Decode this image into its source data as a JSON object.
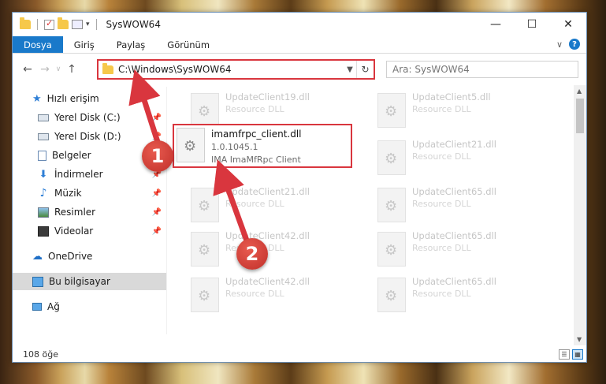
{
  "window": {
    "title": "SysWOW64",
    "controls": {
      "minimize": "—",
      "maximize": "☐",
      "close": "✕"
    }
  },
  "ribbon": {
    "tabs": [
      "Dosya",
      "Giriş",
      "Paylaş",
      "Görünüm"
    ],
    "expand": "∨",
    "help": "?"
  },
  "address": {
    "path": "C:\\Windows\\SysWOW64",
    "refresh": "↻"
  },
  "search": {
    "placeholder": "Ara: SysWOW64"
  },
  "nav": {
    "quick_access": "Hızlı erişim",
    "items": [
      {
        "label": "Yerel Disk (C:)",
        "icon": "drive-icon"
      },
      {
        "label": "Yerel Disk (D:)",
        "icon": "drive-icon"
      },
      {
        "label": "Belgeler",
        "icon": "documents-icon"
      },
      {
        "label": "İndirmeler",
        "icon": "download-icon"
      },
      {
        "label": "Müzik",
        "icon": "music-icon"
      },
      {
        "label": "Resimler",
        "icon": "pictures-icon"
      },
      {
        "label": "Videolar",
        "icon": "video-icon"
      }
    ],
    "onedrive": "OneDrive",
    "this_pc": "Bu bilgisayar",
    "network": "Ağ"
  },
  "files": {
    "background": [
      {
        "name": "UpdateClient19.dll",
        "type": "Resource DLL"
      },
      {
        "name": "UpdateClient5.dll",
        "type": "Resource DLL"
      },
      {
        "name": "UpdateClient21.dll",
        "type": "Resource DLL"
      },
      {
        "name": "UpdateClient21.dll",
        "type": "Resource DLL"
      },
      {
        "name": "UpdateClient65.dll",
        "type": "Resource DLL"
      },
      {
        "name": "UpdateClient42.dll",
        "type": "Resource DLL"
      },
      {
        "name": "UpdateClient65.dll",
        "type": "Resource DLL"
      },
      {
        "name": "UpdateClient42.dll",
        "type": "Resource DLL"
      },
      {
        "name": "UpdateClient65.dll",
        "type": "Resource DLL"
      }
    ],
    "highlighted": {
      "name": "imamfrpc_client.dll",
      "version": "1.0.1045.1",
      "description": "IMA ImaMfRpc Client"
    }
  },
  "status": {
    "count": "108 öğe"
  },
  "annotations": {
    "step1": "1",
    "step2": "2",
    "color": "#d9363e"
  }
}
